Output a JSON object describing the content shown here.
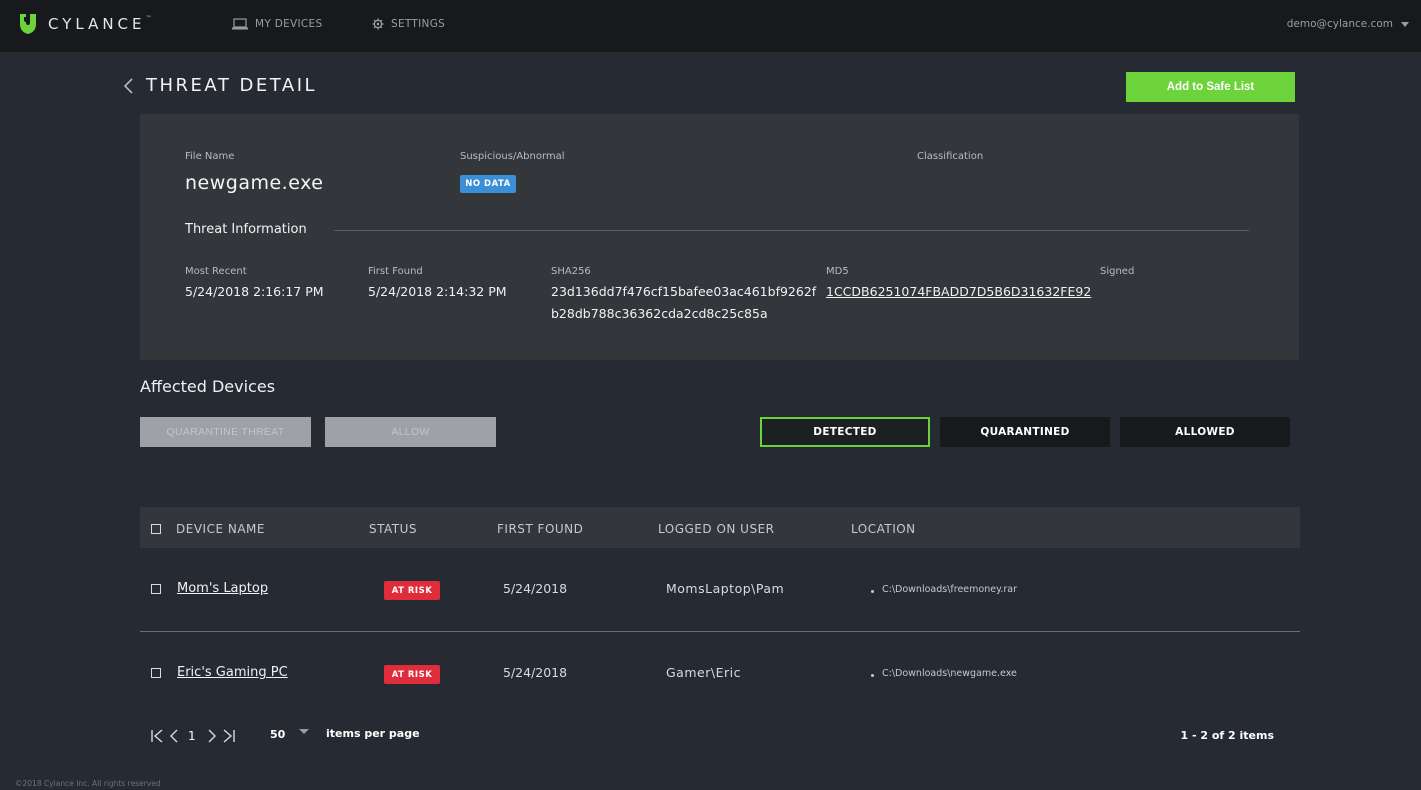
{
  "brand": {
    "name": "CYLANCE",
    "trademark": "™",
    "accent_color": "#6cd43a"
  },
  "nav": {
    "my_devices": "MY DEVICES",
    "settings": "SETTINGS",
    "user": "demo@cylance.com"
  },
  "header": {
    "title": "THREAT DETAIL",
    "safe_list_button": "Add to Safe List"
  },
  "detail": {
    "file_name_label": "File Name",
    "file_name": "newgame.exe",
    "suspicious_label": "Suspicious/Abnormal",
    "suspicious_badge": "NO DATA",
    "classification_label": "Classification",
    "threat_info_heading": "Threat Information",
    "most_recent_label": "Most Recent",
    "most_recent": "5/24/2018 2:16:17 PM",
    "first_found_label": "First Found",
    "first_found": "5/24/2018 2:14:32 PM",
    "sha256_label": "SHA256",
    "sha256_line1": "23d136dd7f476cf15bafee03ac461bf9262f",
    "sha256_line2": "b28db788c36362cda2cd8c25c85a",
    "md5_label": "MD5",
    "md5": "1CCDB6251074FBADD7D5B6D31632FE92",
    "signed_label": "Signed"
  },
  "affected": {
    "title": "Affected Devices",
    "quarantine_button": "QUARANTINE THREAT",
    "allow_button": "ALLOW",
    "tabs": {
      "detected": "DETECTED",
      "quarantined": "QUARANTINED",
      "allowed": "ALLOWED"
    }
  },
  "table": {
    "columns": {
      "device_name": "DEVICE NAME",
      "status": "STATUS",
      "first_found": "FIRST FOUND",
      "logged_on_user": "LOGGED ON USER",
      "location": "LOCATION"
    },
    "rows": [
      {
        "device_name": "Mom's Laptop",
        "status": "AT RISK",
        "first_found": "5/24/2018",
        "user": "MomsLaptop\\Pam",
        "location": "C:\\Downloads\\freemoney.rar"
      },
      {
        "device_name": "Eric's Gaming PC",
        "status": "AT RISK",
        "first_found": "5/24/2018",
        "user": "Gamer\\Eric",
        "location": "C:\\Downloads\\newgame.exe"
      }
    ]
  },
  "pagination": {
    "page": "1",
    "per_page": "50",
    "per_page_label": "items per page",
    "count": "1 - 2 of 2 items"
  },
  "footer": "©2018 Cylance Inc. All rights reserved"
}
